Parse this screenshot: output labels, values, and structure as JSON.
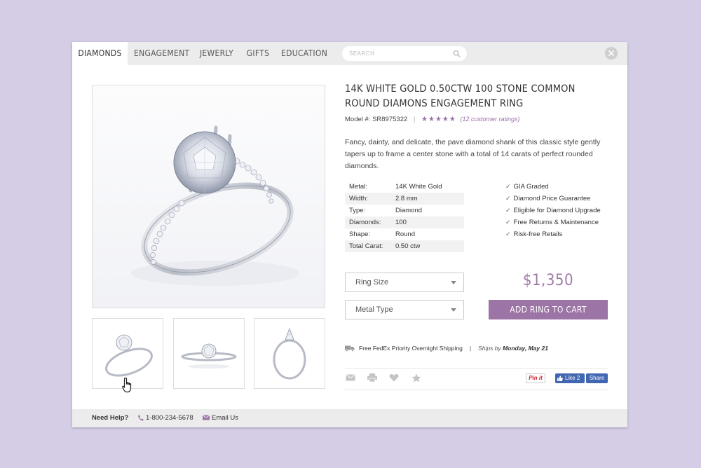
{
  "nav": {
    "tabs": [
      {
        "label": "DIAMONDS",
        "active": true
      },
      {
        "label": "ENGAGEMENT",
        "active": false
      },
      {
        "label": "JEWERLY",
        "active": false
      },
      {
        "label": "GIFTS",
        "active": false
      },
      {
        "label": "EDUCATION",
        "active": false
      }
    ],
    "search_placeholder": "SEARCH"
  },
  "product": {
    "title": "14K WHITE GOLD 0.50CTW 100 STONE COMMON ROUND DIAMONS ENGAGEMENT RING",
    "model_label": "Model #:",
    "model_number": "SR8975322",
    "stars": "★★★★★",
    "rating_count": 5,
    "ratings_text": "(12 customer ratings)",
    "description": "Fancy, dainty, and delicate, the pave diamond shank of this classic style gently tapers up to frame a center stone with a total of 14 carats of perfect rounded diamonds.",
    "specs": [
      {
        "key": "Metal:",
        "value": "14K White Gold"
      },
      {
        "key": "Width:",
        "value": "2.8 mm"
      },
      {
        "key": "Type:",
        "value": "Diamond"
      },
      {
        "key": "Diamonds:",
        "value": "100"
      },
      {
        "key": "Shape:",
        "value": "Round"
      },
      {
        "key": "Total Carat:",
        "value": "0.50 ctw"
      }
    ],
    "features": [
      "GIA Graded",
      "Diamond Price Guarantee",
      "Eligible for Diamond Upgrade",
      "Free Returns & Maintenance",
      "Risk-free Retails"
    ],
    "ring_size_label": "Ring Size",
    "metal_type_label": "Metal Type",
    "price": "$1,350",
    "add_to_cart_label": "ADD RING TO CART"
  },
  "shipping": {
    "text": "Free FedEx Priority Overnight Shipping",
    "ships_by_label": "Ships by",
    "ships_date": "Monday, May 21"
  },
  "social": {
    "pinit_label": "Pin it",
    "like_label": "Like 2",
    "share_label": "Share"
  },
  "footer": {
    "help_label": "Need Help?",
    "phone": "1-800-234-5678",
    "email_label": "Email Us"
  },
  "colors": {
    "accent": "#9c74a5",
    "price": "#a07aa8",
    "background": "#d5cce6",
    "facebook": "#4267b2"
  }
}
